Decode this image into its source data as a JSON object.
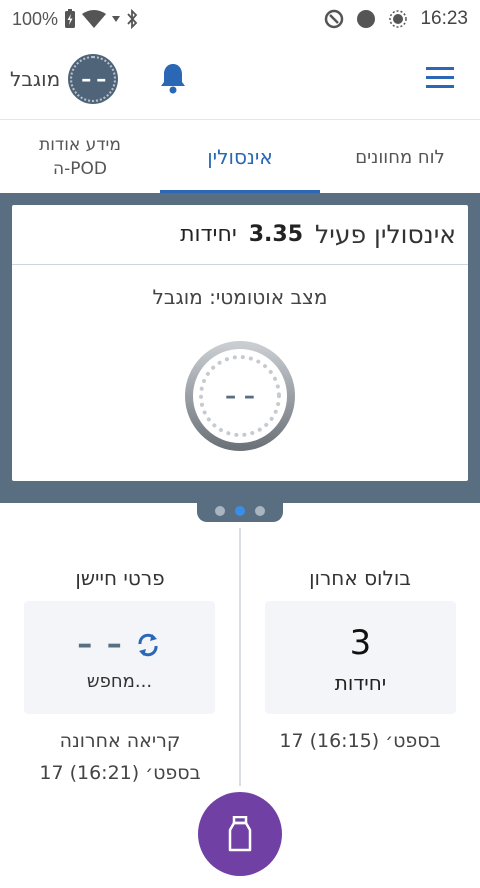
{
  "status_bar": {
    "battery": "100%",
    "time": "16:23"
  },
  "header": {
    "status_label": "מוגבל",
    "status_badge": "– –"
  },
  "tabs": {
    "dashboard": "לוח מחוונים",
    "insulin": "אינסולין",
    "pod_info_line1": "מידע אודות",
    "pod_info_line2": "ה-POD"
  },
  "card": {
    "title": "אינסולין פעיל",
    "value": "3.35",
    "unit": "יחידות",
    "auto_mode": "מצב אוטומטי: מוגבל",
    "gauge_text": "– –"
  },
  "last_bolus": {
    "title": "בולוס אחרון",
    "amount": "3",
    "unit": "יחידות",
    "time": "17 בספט׳ (16:15)"
  },
  "sensor": {
    "title": "פרטי חיישן",
    "value": "– –",
    "status": "מחפש...",
    "last_reading_label": "קריאה אחרונה",
    "last_reading_time": "17 בספט׳ (16:21)"
  },
  "pager": {
    "active_index": 1,
    "count": 3
  },
  "colors": {
    "accent": "#2a68b6",
    "carousel_bg": "#5a6e82",
    "fab": "#7040a4"
  }
}
